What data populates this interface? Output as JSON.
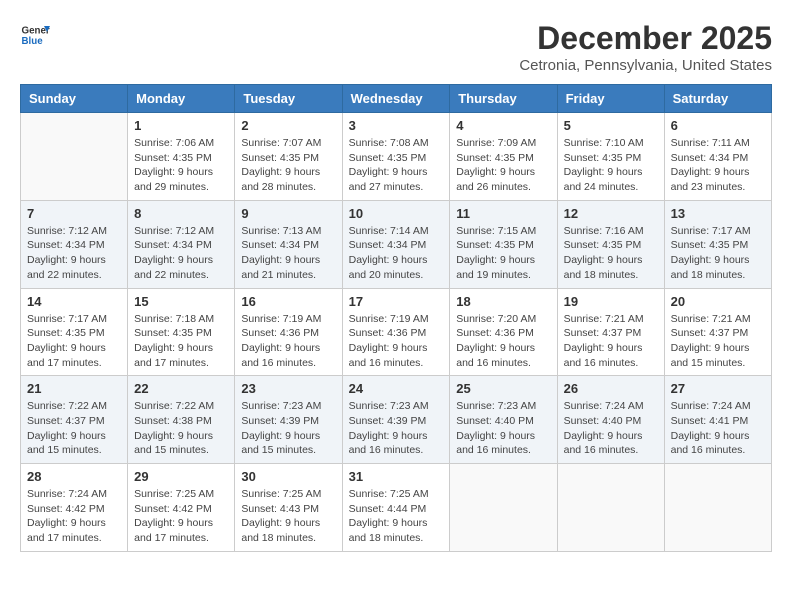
{
  "logo": {
    "text_general": "General",
    "text_blue": "Blue"
  },
  "title": {
    "month_year": "December 2025",
    "location": "Cetronia, Pennsylvania, United States"
  },
  "days_of_week": [
    "Sunday",
    "Monday",
    "Tuesday",
    "Wednesday",
    "Thursday",
    "Friday",
    "Saturday"
  ],
  "weeks": [
    [
      {
        "day": "",
        "sunrise": "",
        "sunset": "",
        "daylight": ""
      },
      {
        "day": "1",
        "sunrise": "Sunrise: 7:06 AM",
        "sunset": "Sunset: 4:35 PM",
        "daylight": "Daylight: 9 hours and 29 minutes."
      },
      {
        "day": "2",
        "sunrise": "Sunrise: 7:07 AM",
        "sunset": "Sunset: 4:35 PM",
        "daylight": "Daylight: 9 hours and 28 minutes."
      },
      {
        "day": "3",
        "sunrise": "Sunrise: 7:08 AM",
        "sunset": "Sunset: 4:35 PM",
        "daylight": "Daylight: 9 hours and 27 minutes."
      },
      {
        "day": "4",
        "sunrise": "Sunrise: 7:09 AM",
        "sunset": "Sunset: 4:35 PM",
        "daylight": "Daylight: 9 hours and 26 minutes."
      },
      {
        "day": "5",
        "sunrise": "Sunrise: 7:10 AM",
        "sunset": "Sunset: 4:35 PM",
        "daylight": "Daylight: 9 hours and 24 minutes."
      },
      {
        "day": "6",
        "sunrise": "Sunrise: 7:11 AM",
        "sunset": "Sunset: 4:34 PM",
        "daylight": "Daylight: 9 hours and 23 minutes."
      }
    ],
    [
      {
        "day": "7",
        "sunrise": "Sunrise: 7:12 AM",
        "sunset": "Sunset: 4:34 PM",
        "daylight": "Daylight: 9 hours and 22 minutes."
      },
      {
        "day": "8",
        "sunrise": "Sunrise: 7:12 AM",
        "sunset": "Sunset: 4:34 PM",
        "daylight": "Daylight: 9 hours and 22 minutes."
      },
      {
        "day": "9",
        "sunrise": "Sunrise: 7:13 AM",
        "sunset": "Sunset: 4:34 PM",
        "daylight": "Daylight: 9 hours and 21 minutes."
      },
      {
        "day": "10",
        "sunrise": "Sunrise: 7:14 AM",
        "sunset": "Sunset: 4:34 PM",
        "daylight": "Daylight: 9 hours and 20 minutes."
      },
      {
        "day": "11",
        "sunrise": "Sunrise: 7:15 AM",
        "sunset": "Sunset: 4:35 PM",
        "daylight": "Daylight: 9 hours and 19 minutes."
      },
      {
        "day": "12",
        "sunrise": "Sunrise: 7:16 AM",
        "sunset": "Sunset: 4:35 PM",
        "daylight": "Daylight: 9 hours and 18 minutes."
      },
      {
        "day": "13",
        "sunrise": "Sunrise: 7:17 AM",
        "sunset": "Sunset: 4:35 PM",
        "daylight": "Daylight: 9 hours and 18 minutes."
      }
    ],
    [
      {
        "day": "14",
        "sunrise": "Sunrise: 7:17 AM",
        "sunset": "Sunset: 4:35 PM",
        "daylight": "Daylight: 9 hours and 17 minutes."
      },
      {
        "day": "15",
        "sunrise": "Sunrise: 7:18 AM",
        "sunset": "Sunset: 4:35 PM",
        "daylight": "Daylight: 9 hours and 17 minutes."
      },
      {
        "day": "16",
        "sunrise": "Sunrise: 7:19 AM",
        "sunset": "Sunset: 4:36 PM",
        "daylight": "Daylight: 9 hours and 16 minutes."
      },
      {
        "day": "17",
        "sunrise": "Sunrise: 7:19 AM",
        "sunset": "Sunset: 4:36 PM",
        "daylight": "Daylight: 9 hours and 16 minutes."
      },
      {
        "day": "18",
        "sunrise": "Sunrise: 7:20 AM",
        "sunset": "Sunset: 4:36 PM",
        "daylight": "Daylight: 9 hours and 16 minutes."
      },
      {
        "day": "19",
        "sunrise": "Sunrise: 7:21 AM",
        "sunset": "Sunset: 4:37 PM",
        "daylight": "Daylight: 9 hours and 16 minutes."
      },
      {
        "day": "20",
        "sunrise": "Sunrise: 7:21 AM",
        "sunset": "Sunset: 4:37 PM",
        "daylight": "Daylight: 9 hours and 15 minutes."
      }
    ],
    [
      {
        "day": "21",
        "sunrise": "Sunrise: 7:22 AM",
        "sunset": "Sunset: 4:37 PM",
        "daylight": "Daylight: 9 hours and 15 minutes."
      },
      {
        "day": "22",
        "sunrise": "Sunrise: 7:22 AM",
        "sunset": "Sunset: 4:38 PM",
        "daylight": "Daylight: 9 hours and 15 minutes."
      },
      {
        "day": "23",
        "sunrise": "Sunrise: 7:23 AM",
        "sunset": "Sunset: 4:39 PM",
        "daylight": "Daylight: 9 hours and 15 minutes."
      },
      {
        "day": "24",
        "sunrise": "Sunrise: 7:23 AM",
        "sunset": "Sunset: 4:39 PM",
        "daylight": "Daylight: 9 hours and 16 minutes."
      },
      {
        "day": "25",
        "sunrise": "Sunrise: 7:23 AM",
        "sunset": "Sunset: 4:40 PM",
        "daylight": "Daylight: 9 hours and 16 minutes."
      },
      {
        "day": "26",
        "sunrise": "Sunrise: 7:24 AM",
        "sunset": "Sunset: 4:40 PM",
        "daylight": "Daylight: 9 hours and 16 minutes."
      },
      {
        "day": "27",
        "sunrise": "Sunrise: 7:24 AM",
        "sunset": "Sunset: 4:41 PM",
        "daylight": "Daylight: 9 hours and 16 minutes."
      }
    ],
    [
      {
        "day": "28",
        "sunrise": "Sunrise: 7:24 AM",
        "sunset": "Sunset: 4:42 PM",
        "daylight": "Daylight: 9 hours and 17 minutes."
      },
      {
        "day": "29",
        "sunrise": "Sunrise: 7:25 AM",
        "sunset": "Sunset: 4:42 PM",
        "daylight": "Daylight: 9 hours and 17 minutes."
      },
      {
        "day": "30",
        "sunrise": "Sunrise: 7:25 AM",
        "sunset": "Sunset: 4:43 PM",
        "daylight": "Daylight: 9 hours and 18 minutes."
      },
      {
        "day": "31",
        "sunrise": "Sunrise: 7:25 AM",
        "sunset": "Sunset: 4:44 PM",
        "daylight": "Daylight: 9 hours and 18 minutes."
      },
      {
        "day": "",
        "sunrise": "",
        "sunset": "",
        "daylight": ""
      },
      {
        "day": "",
        "sunrise": "",
        "sunset": "",
        "daylight": ""
      },
      {
        "day": "",
        "sunrise": "",
        "sunset": "",
        "daylight": ""
      }
    ]
  ]
}
